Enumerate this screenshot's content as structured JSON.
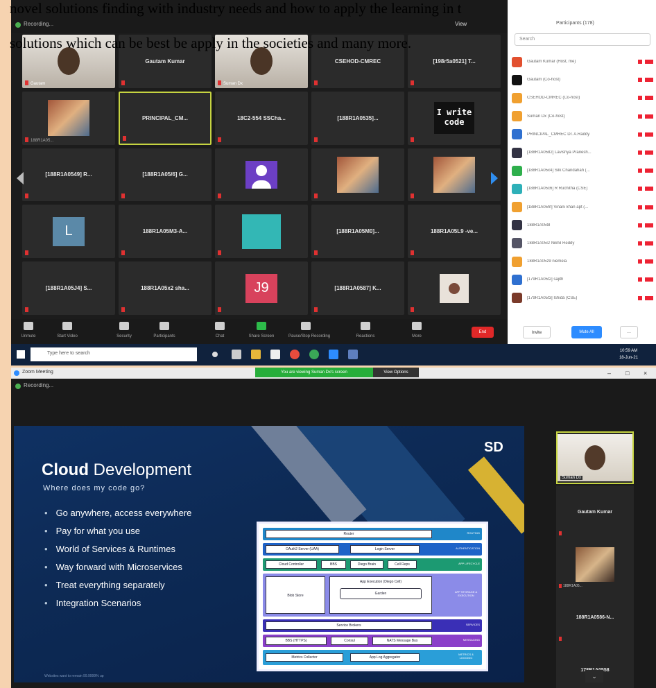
{
  "document": {
    "line1": "novel solutions finding with industry needs and how to apply the learning in t",
    "line2": "solutions which can be best be apply in the societies and many more."
  },
  "meeting1": {
    "recording_label": "Recording...",
    "view_label": "View",
    "participants_header": "Participants (178)",
    "search_placeholder": "Search",
    "tiles": [
      {
        "name": "Gautam",
        "kind": "camera"
      },
      {
        "name": "Gautam Kumar",
        "kind": "name"
      },
      {
        "name": "Suman Dx",
        "kind": "camera"
      },
      {
        "name": "CSEHOD-CMREC",
        "kind": "name"
      },
      {
        "name": "[198r5a0521] T...",
        "kind": "name"
      },
      {
        "name": "188R1A05...",
        "kind": "photo"
      },
      {
        "name": "PRINCIPAL_CM...",
        "kind": "name",
        "active": true
      },
      {
        "name": "18C2-554 SSCha...",
        "kind": "name"
      },
      {
        "name": "[188R1A0535]...",
        "kind": "name"
      },
      {
        "name": "I write code",
        "kind": "code"
      },
      {
        "name": "[188R1A0549] R...",
        "kind": "name"
      },
      {
        "name": "[188R1A05/6] G...",
        "kind": "name"
      },
      {
        "name": "",
        "kind": "avatar"
      },
      {
        "name": "",
        "kind": "photo"
      },
      {
        "name": "",
        "kind": "photo2"
      },
      {
        "name": "L",
        "kind": "letter",
        "color": "#5b89a8"
      },
      {
        "name": "188R1A05M3-A...",
        "kind": "name"
      },
      {
        "name": "",
        "kind": "teal"
      },
      {
        "name": "[188R1A05M0]...",
        "kind": "name"
      },
      {
        "name": "188R1A05L9 -ve...",
        "kind": "name"
      },
      {
        "name": "[188R1A05J4] S...",
        "kind": "name"
      },
      {
        "name": "188R1A05x2 sha...",
        "kind": "name"
      },
      {
        "name": "J9",
        "kind": "letter",
        "color": "#d8425c"
      },
      {
        "name": "[188R1A0587] K...",
        "kind": "name"
      },
      {
        "name": "",
        "kind": "user-photo"
      }
    ],
    "toolbar": [
      {
        "label": "Unmute",
        "icon": "mic-icon"
      },
      {
        "label": "Start Video",
        "icon": "video-icon"
      },
      {
        "label": "Security",
        "icon": "shield-icon"
      },
      {
        "label": "Participants",
        "icon": "participants-icon"
      },
      {
        "label": "Chat",
        "icon": "chat-icon"
      },
      {
        "label": "Share Screen",
        "icon": "share-screen-icon"
      },
      {
        "label": "Pause/Stop Recording",
        "icon": "record-icon"
      },
      {
        "label": "Reactions",
        "icon": "reactions-icon"
      },
      {
        "label": "More",
        "icon": "more-icon"
      }
    ],
    "end_label": "End",
    "participants": [
      {
        "name": "Gautam Kumar (Host, me)",
        "color": "#e2502f"
      },
      {
        "name": "Gautam (Co-host)",
        "color": "#111111"
      },
      {
        "name": "CSEHOD-CMREC (Co-host)",
        "color": "#f0a030"
      },
      {
        "name": "Suman Dx (Co-host)",
        "color": "#f0a030"
      },
      {
        "name": "PRINCIPAL_CMREC Dr. A.Raddy",
        "color": "#2f70d0"
      },
      {
        "name": "[188R1A0582] Lavishya Pranesh...",
        "color": "#334"
      },
      {
        "name": "[188R1A05x4] Silk Chandahah (...",
        "color": "#2eaf4c"
      },
      {
        "name": "[188R1A05c6] R Ruchitha (CSE)",
        "color": "#2eb0b8"
      },
      {
        "name": "[188R1A05hf] Vinani khan apt (...",
        "color": "#f0a030"
      },
      {
        "name": "188R1A05t8",
        "color": "#334"
      },
      {
        "name": "188R1A05l2 Nikhil Reddy",
        "color": "#556"
      },
      {
        "name": "188R1A05z9 niemela",
        "color": "#f0a030"
      },
      {
        "name": "[179R1A05t2] sajith",
        "color": "#2f70d0"
      },
      {
        "name": "[179R1A05t3] Ishida (CSE)",
        "color": "#7a3a2a"
      }
    ],
    "invite_label": "Invite",
    "mute_all_label": "Mute All",
    "taskbar_search": "Type here to search",
    "clock_time": "10:59 AM",
    "clock_date": "18-Jun-21"
  },
  "meeting2": {
    "window_title": "Zoom Meeting",
    "share_banner": "You are viewing Suman Dx's screen",
    "view_options": "View Options",
    "recording_label": "Recording...",
    "slide": {
      "logo": "SD",
      "title_bold": "Cloud",
      "title_rest": " Development",
      "subtitle": "Where does my code go?",
      "bullets": [
        "Go anywhere, access everywhere",
        "Pay for what you use",
        "World of Services & Runtimes",
        "Way forward with Microservices",
        "Treat everything separately",
        "Integration Scenarios"
      ],
      "diagram": {
        "router": "Router",
        "routing": "ROUTING",
        "oauth": "OAuth2 Server (UAA)",
        "login": "Login Server",
        "authentication": "AUTHENTICATION",
        "cloud_controller": "Cloud Controller",
        "bbs": "BBS",
        "diego_brain": "Diego Brain",
        "cell_reps": "Cell Reps",
        "app_lifecycle": "APP LIFECYCLE",
        "blob_store": "Blob Store",
        "app_execution": "App Execution (Diego Cell)",
        "garden": "Garden",
        "app_storage": "APP STORAGE & EXECUTION",
        "service_brokers": "Service Brokers",
        "services": "SERVICES",
        "bbs_http": "BBS (HTTPS)",
        "consul": "Consul",
        "nats": "NATS Message Bus",
        "messaging": "MESSAGING",
        "metrics_collector": "Metrics Collector",
        "log_aggregator": "App Log Aggregator",
        "metrics_logging": "METRICS & LOGGING"
      },
      "footer": "Websites want to remain 99.9999% up"
    },
    "side_tiles": [
      {
        "name": "Suman Dx",
        "kind": "camera"
      },
      {
        "name": "Gautam Kumar",
        "kind": "name"
      },
      {
        "name": "188R1A05...",
        "kind": "photo"
      },
      {
        "name": "188R1A0586-N...",
        "kind": "name"
      },
      {
        "name": "178R1A0558",
        "kind": "name"
      }
    ]
  }
}
